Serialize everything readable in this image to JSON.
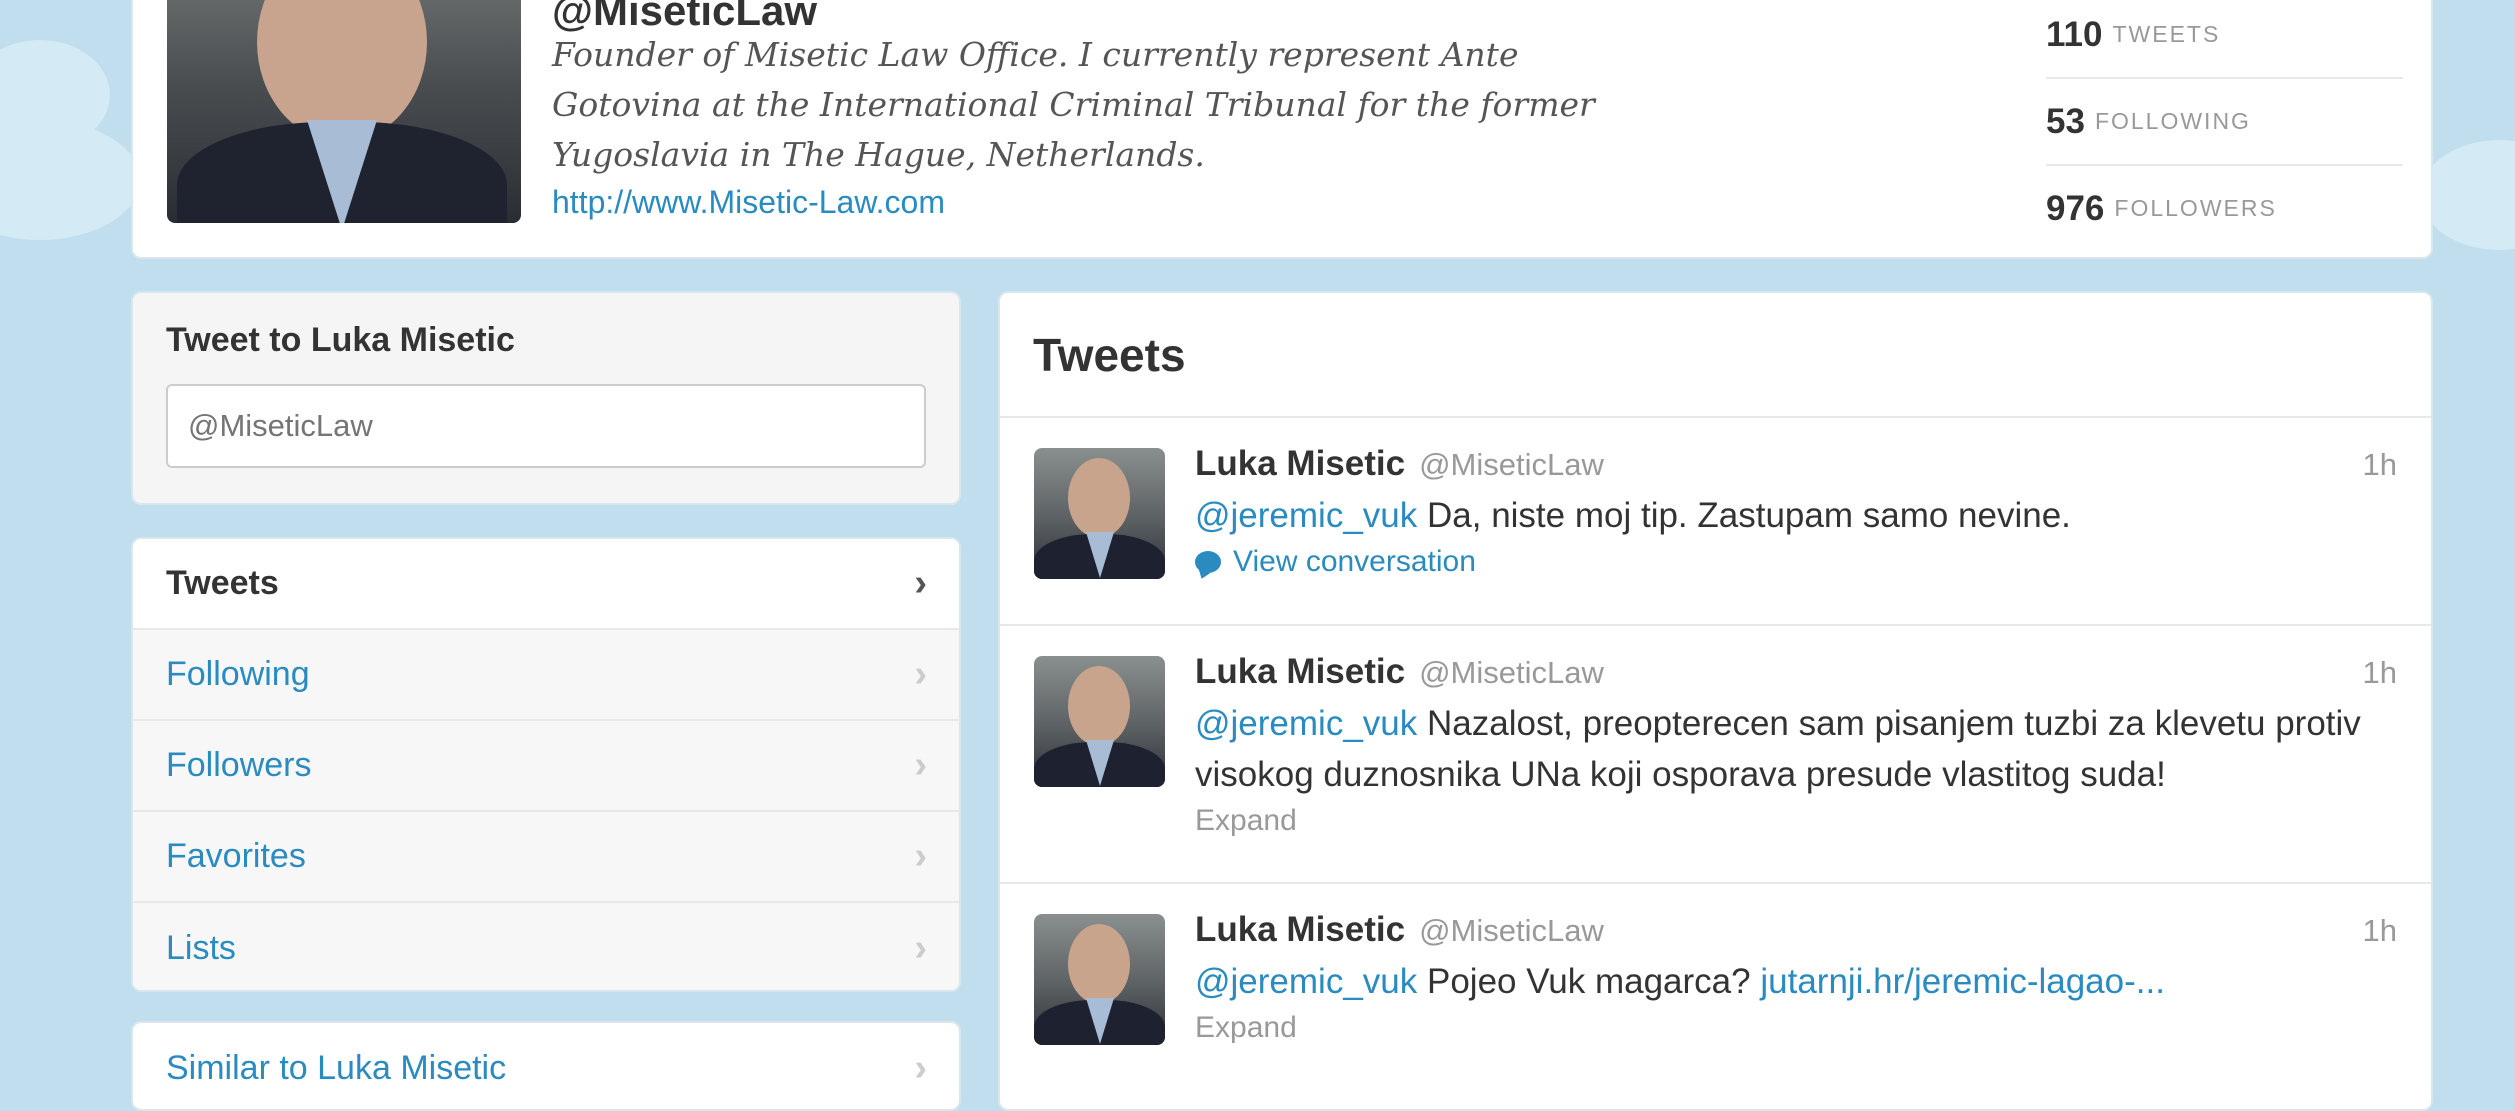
{
  "profile": {
    "handle": "@MiseticLaw",
    "bio": "Founder of Misetic Law Office. I currently represent Ante Gotovina at the International Criminal Tribunal for the former Yugoslavia in The Hague, Netherlands.",
    "url": "http://www.Misetic-Law.com",
    "stats": [
      {
        "num": "110",
        "label": "TWEETS"
      },
      {
        "num": "53",
        "label": "FOLLOWING"
      },
      {
        "num": "976",
        "label": "FOLLOWERS"
      }
    ]
  },
  "compose": {
    "title": "Tweet to Luka Misetic",
    "placeholder": "@MiseticLaw"
  },
  "nav": {
    "items": [
      {
        "label": "Tweets",
        "active": true
      },
      {
        "label": "Following"
      },
      {
        "label": "Followers"
      },
      {
        "label": "Favorites"
      },
      {
        "label": "Lists"
      }
    ],
    "similar": "Similar to Luka Misetic"
  },
  "tweets": {
    "heading": "Tweets",
    "items": [
      {
        "name": "Luka Misetic",
        "handle": "@MiseticLaw",
        "time": "1h",
        "mention": "@jeremic_vuk",
        "text": "Da, niste moj tip. Zastupam samo nevine.",
        "action": "View conversation"
      },
      {
        "name": "Luka Misetic",
        "handle": "@MiseticLaw",
        "time": "1h",
        "mention": "@jeremic_vuk",
        "text": "Nazalost, preopterecen sam pisanjem tuzbi za klevetu protiv visokog duznosnika UNa koji osporava presude vlastitog suda!",
        "action": "Expand"
      },
      {
        "name": "Luka Misetic",
        "handle": "@MiseticLaw",
        "time": "1h",
        "mention": "@jeremic_vuk",
        "text": "Pojeo Vuk magarca?",
        "link": "jutarnji.hr/jeremic-lagao-...",
        "action": "Expand"
      }
    ]
  },
  "colors": {
    "background": "#c0deed",
    "link": "#2a8bc0",
    "text": "#333333",
    "muted": "#999999"
  },
  "icons": {
    "chevron": "chevron-right-icon",
    "conversation": "speech-bubble-icon"
  }
}
